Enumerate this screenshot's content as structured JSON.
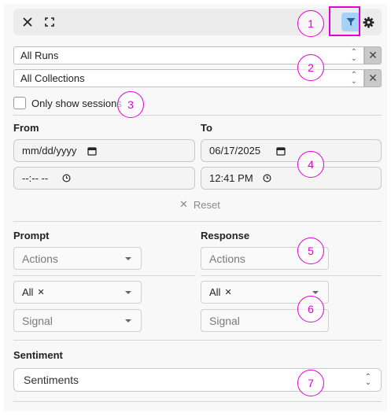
{
  "toolbar": {
    "close_icon": "close-icon",
    "expand_icon": "expand-icon",
    "filter_icon": "filter-icon",
    "settings_icon": "gear-icon"
  },
  "runs_select": {
    "value": "All Runs",
    "clear_label": "✕"
  },
  "collections_select": {
    "value": "All Collections",
    "clear_label": "✕"
  },
  "sessions_checkbox": {
    "label": "Only show sessions",
    "checked": false
  },
  "date_range": {
    "from_label": "From",
    "to_label": "To",
    "from_date": "mm/dd/yyyy",
    "from_time": "--:-- --",
    "to_date": "06/17/2025",
    "to_time": "12:41 PM",
    "reset_icon": "✕",
    "reset_label": "Reset"
  },
  "prompt": {
    "heading": "Prompt",
    "actions_placeholder": "Actions",
    "chip_label": "All",
    "chip_remove": "✕",
    "signal_placeholder": "Signal"
  },
  "response": {
    "heading": "Response",
    "actions_placeholder": "Actions",
    "chip_label": "All",
    "chip_remove": "✕",
    "signal_placeholder": "Signal"
  },
  "sentiment": {
    "heading": "Sentiment",
    "placeholder": "Sentiments"
  },
  "callouts": [
    "1",
    "2",
    "3",
    "4",
    "5",
    "6",
    "7"
  ],
  "colors": {
    "callout": "#e500d5",
    "filter_active_bg": "#a6d3f5",
    "filter_icon": "#1f5f9a"
  }
}
